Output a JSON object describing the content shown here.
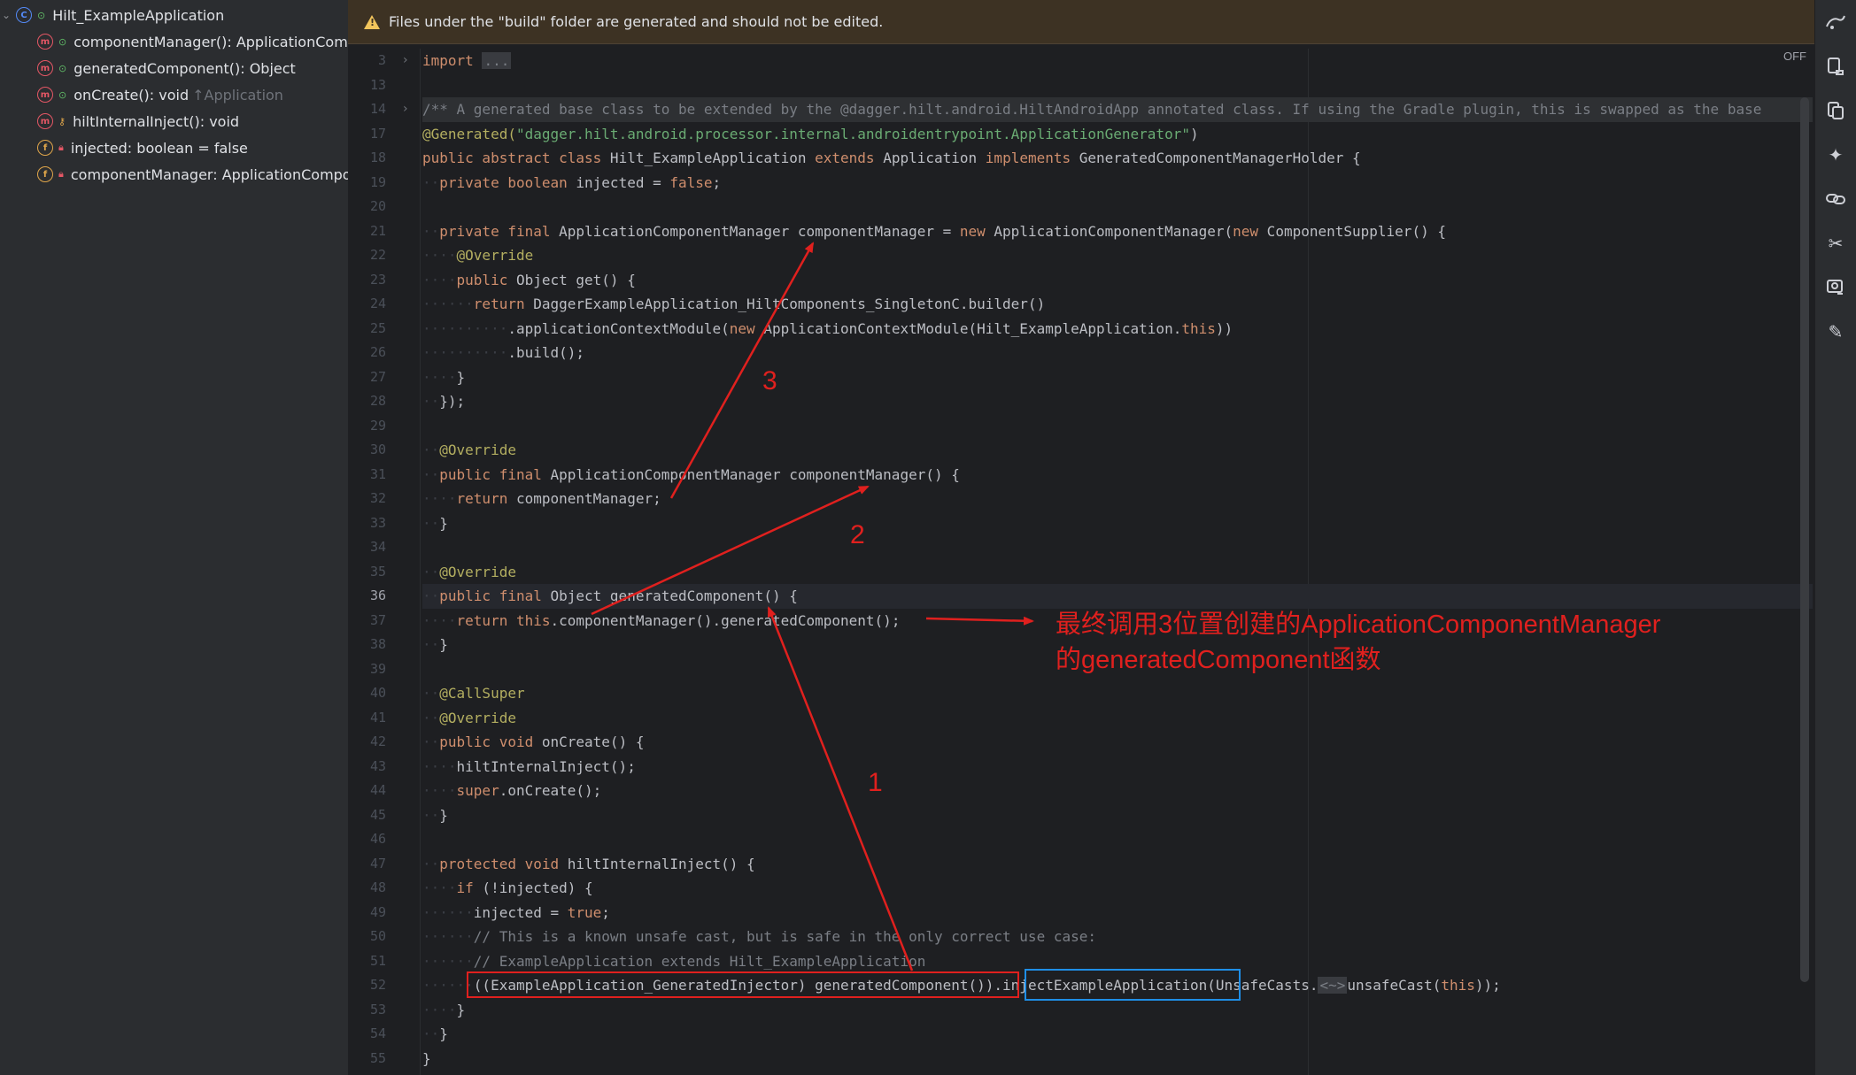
{
  "structure": {
    "root": {
      "label": "Hilt_ExampleApplication"
    },
    "items": [
      {
        "label": "componentManager(): ApplicationCompo",
        "hint": "",
        "icon": "method-icon",
        "badge": "m"
      },
      {
        "label": "generatedComponent(): Object",
        "hint": "",
        "icon": "method-icon",
        "badge": "m"
      },
      {
        "label": "onCreate(): void",
        "hint": "↑Application",
        "icon": "method-icon",
        "badge": "m"
      },
      {
        "label": "hiltInternalInject(): void",
        "hint": "",
        "icon": "method-icon",
        "badge": "m"
      },
      {
        "label": "injected: boolean = false",
        "hint": "",
        "icon": "field-icon",
        "badge": "f"
      },
      {
        "label": "componentManager: ApplicationCompon",
        "hint": "",
        "icon": "field-icon",
        "badge": "f"
      }
    ]
  },
  "banner": {
    "text": "Files under the \"build\" folder are generated and should not be edited."
  },
  "editor": {
    "off_label": "OFF",
    "current_line": "36",
    "line_numbers": [
      "3",
      "13",
      "14",
      "17",
      "18",
      "19",
      "20",
      "21",
      "22",
      "23",
      "24",
      "25",
      "26",
      "27",
      "28",
      "29",
      "30",
      "31",
      "32",
      "33",
      "34",
      "35",
      "36",
      "37",
      "38",
      "39",
      "40",
      "41",
      "42",
      "43",
      "44",
      "45",
      "46",
      "47",
      "48",
      "49",
      "50",
      "51",
      "52",
      "53",
      "54",
      "55"
    ],
    "code": {
      "l3_kw": "import",
      "l3_fold": "...",
      "l14": "/** A generated base class to be extended by the @dagger.hilt.android.HiltAndroidApp annotated class. If using the Gradle plugin, this is swapped as the base",
      "l17_ann": "@Generated(",
      "l17_str": "\"dagger.hilt.android.processor.internal.androidentrypoint.ApplicationGenerator\"",
      "l17_end": ")",
      "l18_kw": "public abstract class",
      "l18_name": " Hilt_ExampleApplication ",
      "l18_kw2": "extends",
      "l18_mid": " Application ",
      "l18_kw3": "implements",
      "l18_end": " GeneratedComponentManagerHolder {",
      "l19_kw": "private boolean",
      "l19_mid": " injected = ",
      "l19_kw2": "false",
      "l19_end": ";",
      "l21_kw": "private final",
      "l21_mid": " ApplicationComponentManager componentManager = ",
      "l21_kw2": "new",
      "l21_mid2": " ApplicationComponentManager(",
      "l21_kw3": "new",
      "l21_end": " ComponentSupplier() {",
      "l22": "@Override",
      "l23_kw": "public",
      "l23_end": " Object get() {",
      "l24_kw": "return",
      "l24_end": " DaggerExampleApplication_HiltComponents_SingletonC.builder()",
      "l25_a": ".applicationContextModule(",
      "l25_kw": "new",
      "l25_b": " ApplicationContextModule(Hilt_ExampleApplication.",
      "l25_kw2": "this",
      "l25_end": "))",
      "l26": ".build();",
      "l27": "}",
      "l28": "});",
      "l30": "@Override",
      "l31_kw": "public final",
      "l31_end": " ApplicationComponentManager componentManager() {",
      "l32_kw": "return",
      "l32_end": " componentManager;",
      "l33": "}",
      "l35": "@Override",
      "l36_kw": "public final",
      "l36_end": " Object generatedComponent() {",
      "l37_kw": "return",
      "l37_kw2": " this",
      "l37_end": ".componentManager().generatedComponent();",
      "l38": "}",
      "l40": "@CallSuper",
      "l41": "@Override",
      "l42_kw": "public void",
      "l42_end": " onCreate() {",
      "l43": "hiltInternalInject();",
      "l44_kw": "super",
      "l44_end": ".onCreate();",
      "l45": "}",
      "l47_kw": "protected void",
      "l47_end": " hiltInternalInject() {",
      "l48_kw": "if",
      "l48_end": " (!injected) {",
      "l49_a": "injected = ",
      "l49_kw": "true",
      "l49_end": ";",
      "l50": "// This is a known unsafe cast, but is safe in the only correct use case:",
      "l51": "// ExampleApplication extends Hilt_ExampleApplication",
      "l52_a": "((ExampleApplication_GeneratedInjector) generatedComponent())",
      "l52_b": ".injectExampleApplication",
      "l52_c": "(UnsafeCasts.",
      "l52_fold": "<~>",
      "l52_d": "unsafeCast(",
      "l52_kw": "this",
      "l52_end": "));",
      "l53": "}",
      "l54": "}",
      "l55": "}"
    }
  },
  "annotations": {
    "num1": "1",
    "num2": "2",
    "num3": "3",
    "note_line1": "最终调用3位置创建的ApplicationComponentManager",
    "note_line2": "的generatedComponent函数",
    "color_red": "#e0201e",
    "color_blue": "#1f8ee6"
  },
  "rightbar": {
    "icons": [
      "gradle-icon",
      "notifications-icon",
      "database-icon",
      "ai-assistant-icon",
      "link-icon",
      "tools-icon",
      "device-manager-icon",
      "edit-icon"
    ]
  }
}
